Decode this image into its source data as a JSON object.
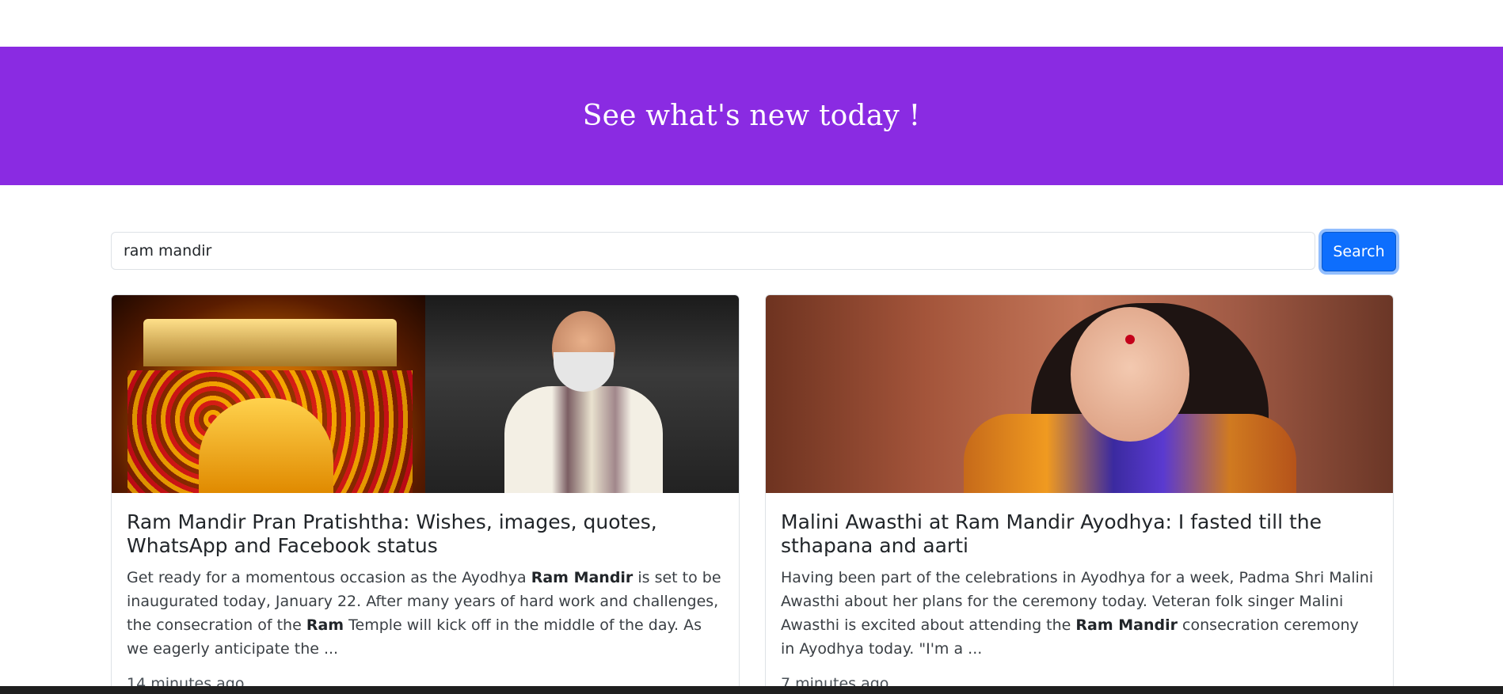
{
  "hero": {
    "title": "See what's new today !"
  },
  "search": {
    "value": "ram mandir",
    "button_label": "Search"
  },
  "cards": [
    {
      "title": "Ram Mandir Pran Pratishtha: Wishes, images, quotes, WhatsApp and Facebook status",
      "text_parts": [
        "Get ready for a momentous occasion as the Ayodhya ",
        "Ram Mandir",
        " is set to be inaugurated today, January 22. After many years of hard work and challenges, the consecration of the ",
        "Ram",
        " Temple will kick off in the middle of the day. As we eagerly anticipate the ..."
      ],
      "time": "14 minutes ago"
    },
    {
      "title": "Malini Awasthi at Ram Mandir Ayodhya: I fasted till the sthapana and aarti",
      "text_parts": [
        "Having been part of the celebrations in Ayodhya for a week, Padma Shri Malini Awasthi about her plans for the ceremony today. Veteran folk singer Malini Awasthi is excited about attending the ",
        "Ram Mandir",
        " consecration ceremony in Ayodhya today. \"I'm a ..."
      ],
      "time": "7 minutes ago"
    }
  ],
  "colors": {
    "hero_bg": "#8a2be2",
    "primary": "#0d6efd"
  }
}
